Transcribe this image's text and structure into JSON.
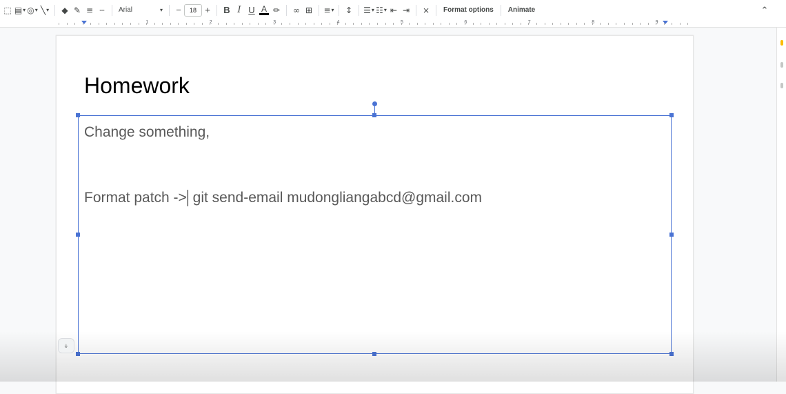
{
  "toolbar": {
    "icons": [
      "select-frame-icon",
      "image-icon",
      "shape-icon",
      "line-icon",
      "fill-color-icon",
      "border-color-icon",
      "border-weight-icon",
      "border-dash-icon",
      "bold-icon",
      "italic-icon",
      "underline-icon",
      "text-color-icon",
      "highlight-icon",
      "link-icon",
      "comment-icon",
      "align-icon",
      "line-spacing-icon",
      "bulleted-list-icon",
      "numbered-list-icon",
      "decrease-indent-icon",
      "increase-indent-icon",
      "clear-formatting-icon",
      "collapse-icon"
    ],
    "font": "Arial",
    "font_size": "18",
    "decrease_label": "−",
    "increase_label": "+",
    "bold_label": "B",
    "italic_label": "I",
    "underline_label": "U",
    "text_color_label": "A",
    "format_options_label": "Format options",
    "animate_label": "Animate",
    "accent_color": "#4a73d4"
  },
  "ruler": {
    "numbers": [
      "1",
      "2",
      "3",
      "4",
      "5",
      "6",
      "7",
      "8",
      "9"
    ]
  },
  "slide": {
    "title": "Homework",
    "body_line_1": "Change something,",
    "body_line_2_before": "Format patch ->",
    "body_line_2_after": " git send-email mudongliangabcd@gmail.com"
  }
}
